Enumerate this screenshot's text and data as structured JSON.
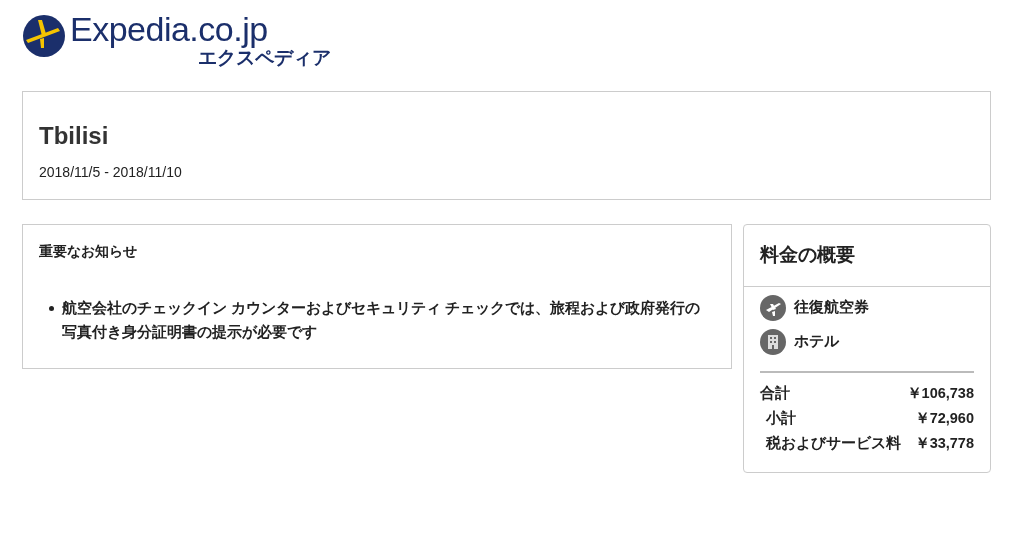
{
  "logo": {
    "name": "Expedia.co.jp",
    "subtitle": "エクスペディア"
  },
  "trip": {
    "destination": "Tbilisi",
    "dates": "2018/11/5 - 2018/11/10"
  },
  "notice": {
    "title": "重要なお知らせ",
    "items": [
      "航空会社のチェックイン カウンターおよびセキュリティ チェックでは、旅程および政府発行の写真付き身分証明書の提示が必要です"
    ]
  },
  "summary": {
    "title": "料金の概要",
    "products": [
      {
        "kind": "flight",
        "label": "往復航空券"
      },
      {
        "kind": "hotel",
        "label": "ホテル"
      }
    ],
    "total": {
      "label": "合計",
      "amount": "￥106,738"
    },
    "lines": [
      {
        "label": "小計",
        "amount": "￥72,960"
      },
      {
        "label": "税およびサービス料",
        "amount": "￥33,778"
      }
    ]
  }
}
